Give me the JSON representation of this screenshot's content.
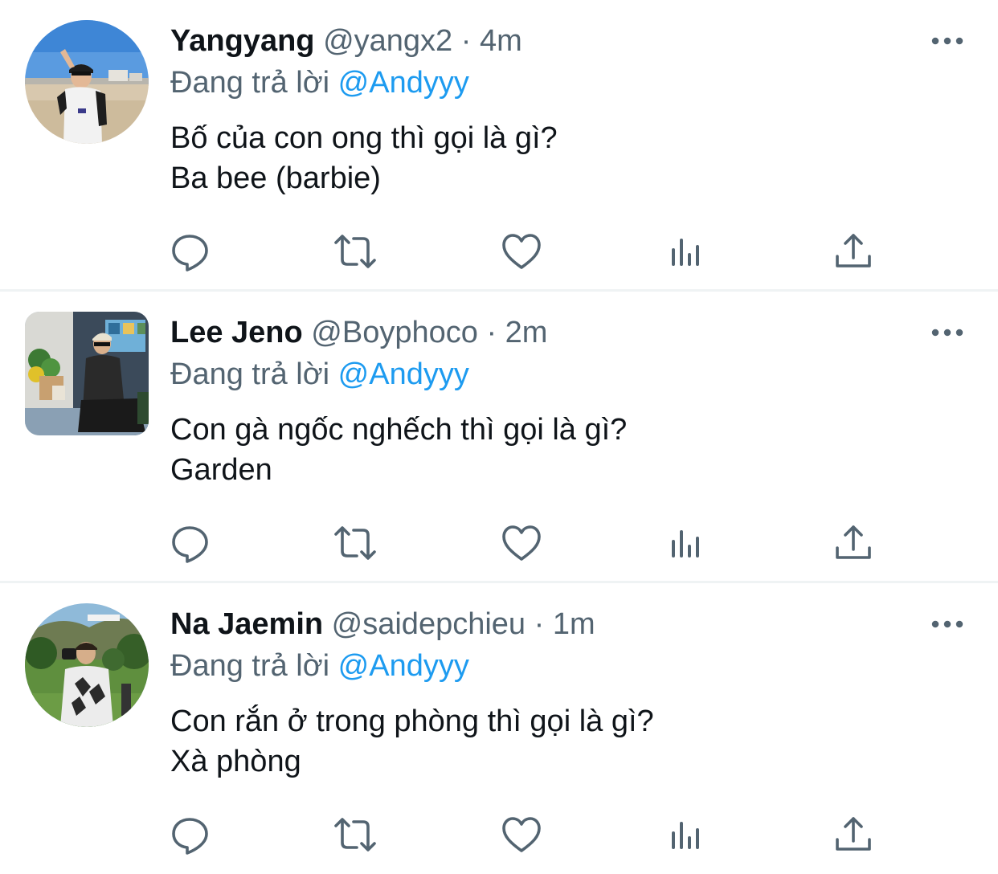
{
  "tweets": [
    {
      "name": "Yangyang",
      "handle": "@yangx2",
      "separator": "·",
      "time": "4m",
      "reply_prefix": "Đang trả lời",
      "reply_to": "@Andyyy",
      "lines": [
        "Bố của con ong thì gọi là gì?",
        "Ba bee (barbie)"
      ],
      "avatar": "beach-photo"
    },
    {
      "name": "Lee Jeno",
      "handle": "@Boyphoco",
      "separator": "·",
      "time": "2m",
      "reply_prefix": "Đang trả lời",
      "reply_to": "@Andyyy",
      "lines": [
        "Con gà ngốc nghếch thì gọi là gì?",
        "Garden"
      ],
      "avatar": "storefront-photo"
    },
    {
      "name": "Na Jaemin",
      "handle": "@saidepchieu",
      "separator": "·",
      "time": "1m",
      "reply_prefix": "Đang trả lời",
      "reply_to": "@Andyyy",
      "lines": [
        "Con rắn ở trong phòng thì gọi là gì?",
        "Xà phòng"
      ],
      "avatar": "park-photo"
    }
  ],
  "icons": {
    "reply": "speech-bubble-icon",
    "retweet": "retweet-icon",
    "like": "heart-icon",
    "views": "bar-chart-icon",
    "share": "share-upload-icon",
    "more": "more-dots-icon"
  },
  "colors": {
    "text": "#0f1419",
    "secondary": "#536471",
    "link": "#1d9bf0",
    "divider": "#eff3f4"
  }
}
